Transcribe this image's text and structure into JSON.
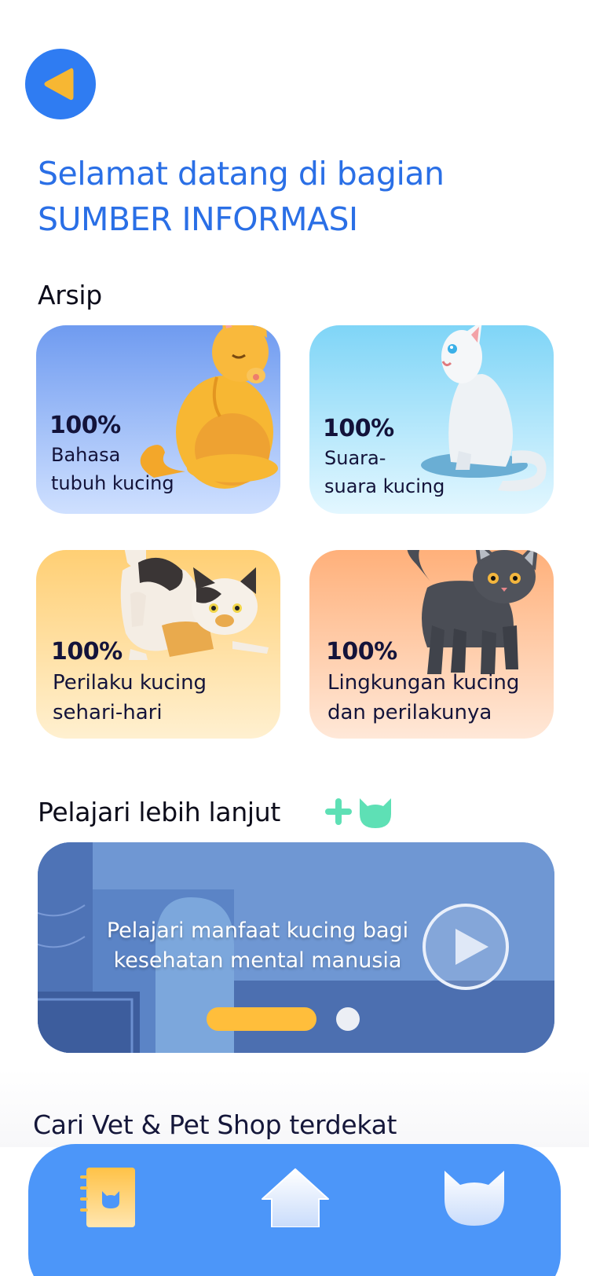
{
  "header": {
    "back_icon": "back-arrow-icon",
    "welcome_line1": "Selamat datang di bagian",
    "welcome_line2": "SUMBER INFORMASI"
  },
  "archive": {
    "title": "Arsip",
    "cards": [
      {
        "percent": "100%",
        "label_line1": "Bahasa",
        "label_line2": "tubuh kucing",
        "illustration": "orange-cat-licking-paw"
      },
      {
        "percent": "100%",
        "label_line1": "Suara-",
        "label_line2": "suara kucing",
        "illustration": "white-cat-sitting"
      },
      {
        "percent": "100%",
        "label_line1": "Perilaku kucing",
        "label_line2": "sehari-hari",
        "illustration": "calico-cat-stretching"
      },
      {
        "percent": "100%",
        "label_line1": "Lingkungan kucing",
        "label_line2": "dan perilakunya",
        "illustration": "black-cat-standing"
      }
    ]
  },
  "learn_more": {
    "title": "Pelajari lebih lanjut",
    "title_icon": "plus-cat-icon",
    "banner_text_line1": "Pelajari manfaat kucing bagi",
    "banner_text_line2": "kesehatan mental manusia",
    "play_icon": "play-icon",
    "slides_total": 2,
    "slide_active": 1
  },
  "vet_section": {
    "title": "Cari Vet & Pet Shop terdekat"
  },
  "navbar": {
    "items": [
      {
        "icon": "notebook-icon"
      },
      {
        "icon": "home-icon"
      },
      {
        "icon": "cat-face-icon"
      }
    ]
  },
  "colors": {
    "accent": "#2f7cf2",
    "title_blue": "#2a6fe6",
    "navbar": "#4c96f9",
    "slider_active": "#ffbe3b",
    "mint": "#5ee0b5"
  }
}
